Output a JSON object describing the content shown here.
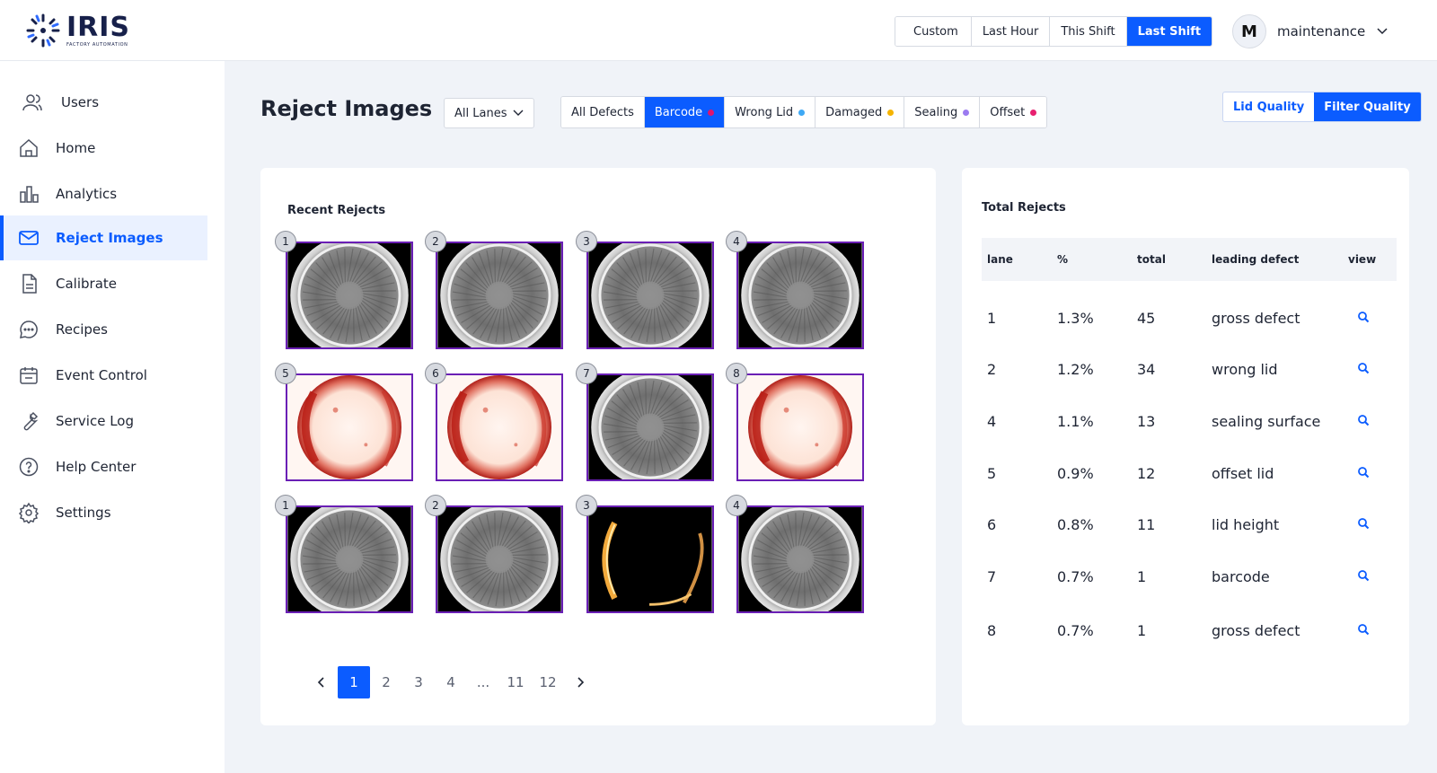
{
  "brand": {
    "name": "IRIS",
    "tagline": "FACTORY AUTOMATION"
  },
  "time_range": {
    "options": [
      "Custom",
      "Last Hour",
      "This Shift",
      "Last Shift"
    ],
    "selected": "Last Shift"
  },
  "user": {
    "initial": "M",
    "name": "maintenance"
  },
  "sidebar": {
    "items": [
      {
        "label": "Users",
        "icon": "users-icon"
      },
      {
        "label": "Home",
        "icon": "home-icon"
      },
      {
        "label": "Analytics",
        "icon": "analytics-icon"
      },
      {
        "label": "Reject Images",
        "icon": "mail-icon",
        "active": true
      },
      {
        "label": "Calibrate",
        "icon": "document-icon"
      },
      {
        "label": "Recipes",
        "icon": "chat-icon"
      },
      {
        "label": "Event Control",
        "icon": "calendar-icon"
      },
      {
        "label": "Service Log",
        "icon": "wrench-icon"
      },
      {
        "label": "Help Center",
        "icon": "help-icon"
      },
      {
        "label": "Settings",
        "icon": "gear-icon"
      }
    ]
  },
  "page": {
    "title": "Reject Images"
  },
  "lane_filter": {
    "selected": "All Lanes"
  },
  "defect_filters": [
    {
      "label": "All Defects",
      "dot": null
    },
    {
      "label": "Barcode",
      "dot": "#e0146e",
      "active": true
    },
    {
      "label": "Wrong Lid",
      "dot": "#3fa9f5"
    },
    {
      "label": "Damaged",
      "dot": "#f5b400"
    },
    {
      "label": "Sealing",
      "dot": "#9b7bf0"
    },
    {
      "label": "Offset",
      "dot": "#e8206f"
    }
  ],
  "quality_toggle": {
    "options": [
      "Lid Quality",
      "Filter Quality"
    ],
    "selected": "Filter Quality"
  },
  "recent_rejects": {
    "title": "Recent Rejects",
    "images": [
      {
        "badge": "1",
        "kind": "gray"
      },
      {
        "badge": "2",
        "kind": "gray"
      },
      {
        "badge": "3",
        "kind": "gray"
      },
      {
        "badge": "4",
        "kind": "gray"
      },
      {
        "badge": "5",
        "kind": "heat"
      },
      {
        "badge": "6",
        "kind": "heat"
      },
      {
        "badge": "7",
        "kind": "gray"
      },
      {
        "badge": "8",
        "kind": "heat"
      },
      {
        "badge": "1",
        "kind": "gray"
      },
      {
        "badge": "2",
        "kind": "gray"
      },
      {
        "badge": "3",
        "kind": "dark"
      },
      {
        "badge": "4",
        "kind": "gray"
      }
    ],
    "pagination": {
      "pages": [
        "1",
        "2",
        "3",
        "4",
        "...",
        "11",
        "12"
      ],
      "current": "1"
    }
  },
  "total_rejects": {
    "title": "Total Rejects",
    "columns": [
      "lane",
      "%",
      "total",
      "leading defect",
      "view"
    ],
    "rows": [
      {
        "lane": "1",
        "pct": "1.3%",
        "total": "45",
        "defect": "gross defect"
      },
      {
        "lane": "2",
        "pct": "1.2%",
        "total": "34",
        "defect": "wrong lid"
      },
      {
        "lane": "4",
        "pct": "1.1%",
        "total": "13",
        "defect": "sealing surface"
      },
      {
        "lane": "5",
        "pct": "0.9%",
        "total": "12",
        "defect": "offset lid"
      },
      {
        "lane": "6",
        "pct": "0.8%",
        "total": "11",
        "defect": "lid height"
      },
      {
        "lane": "7",
        "pct": "0.7%",
        "total": "1",
        "defect": "barcode"
      },
      {
        "lane": "8",
        "pct": "0.7%",
        "total": "1",
        "defect": "gross defect"
      }
    ]
  },
  "colors": {
    "accent": "#0b5cff",
    "thumb_border": "#6a1fb5"
  }
}
